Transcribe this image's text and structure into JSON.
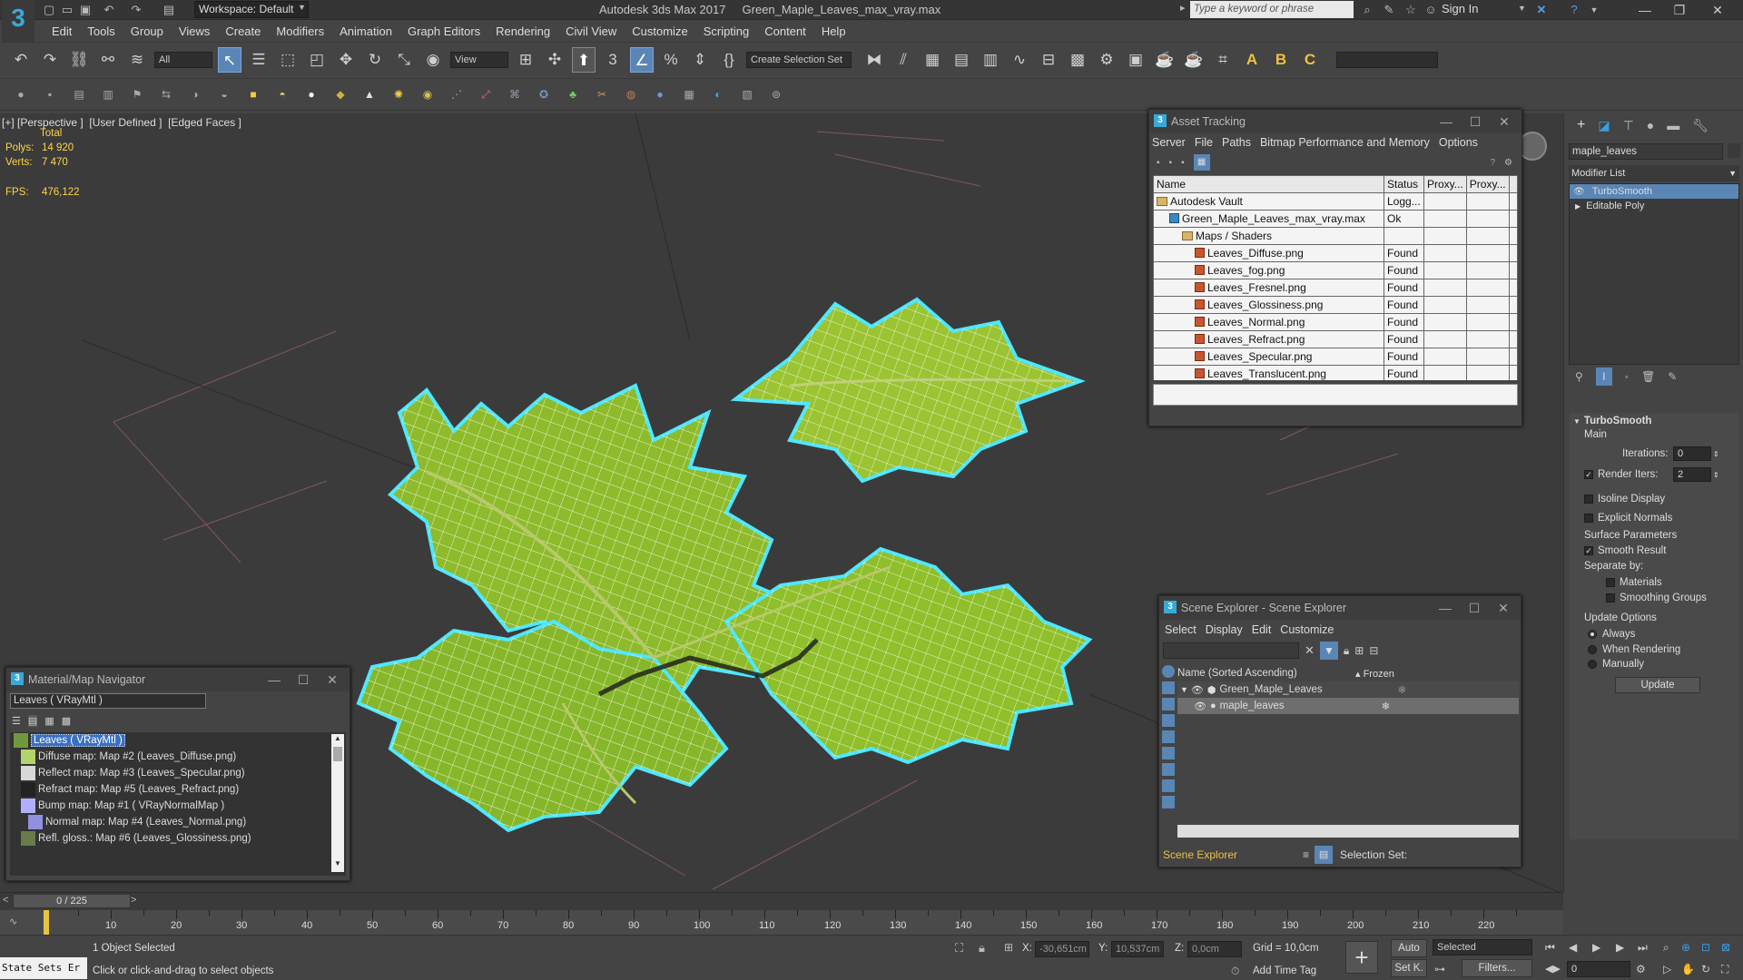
{
  "app": {
    "logo": "3",
    "workspace": "Workspace: Default",
    "title": "Autodesk 3ds Max 2017     Green_Maple_Leaves_max_vray.max",
    "search_placeholder": "Type a keyword or phrase",
    "sign_in": "Sign In",
    "accent": "#5a86b5"
  },
  "menu": [
    "Edit",
    "Tools",
    "Group",
    "Views",
    "Create",
    "Modifiers",
    "Animation",
    "Graph Editors",
    "Rendering",
    "Civil View",
    "Customize",
    "Scripting",
    "Content",
    "Help"
  ],
  "toolbar": {
    "filter": "All",
    "refcoord": "View",
    "selection_set": "Create Selection Set"
  },
  "viewport": {
    "label": "[+] [Perspective ]  [User Defined ]  [Edged Faces ]",
    "total": "Total",
    "polys_label": "Polys:",
    "polys": "14 920",
    "verts_label": "Verts:",
    "verts": "7 470",
    "fps_label": "FPS:",
    "fps": "476,122",
    "mesh_color": "#8fbf2a",
    "outline_color": "#4fe7ff"
  },
  "asset_tracking": {
    "title": "Asset Tracking",
    "menu": [
      "Server",
      "File",
      "Paths",
      "Bitmap Performance and Memory",
      "Options"
    ],
    "columns": [
      "Name",
      "Status",
      "Proxy...",
      "Proxy..."
    ],
    "rows": [
      {
        "name": "Autodesk Vault",
        "status": "Logg...",
        "type": "folder",
        "indent": 0
      },
      {
        "name": "Green_Maple_Leaves_max_vray.max",
        "status": "Ok",
        "type": "max",
        "indent": 1
      },
      {
        "name": "Maps / Shaders",
        "status": "",
        "type": "folder",
        "indent": 2
      },
      {
        "name": "Leaves_Diffuse.png",
        "status": "Found",
        "type": "file",
        "indent": 3
      },
      {
        "name": "Leaves_fog.png",
        "status": "Found",
        "type": "file",
        "indent": 3
      },
      {
        "name": "Leaves_Fresnel.png",
        "status": "Found",
        "type": "file",
        "indent": 3
      },
      {
        "name": "Leaves_Glossiness.png",
        "status": "Found",
        "type": "file",
        "indent": 3
      },
      {
        "name": "Leaves_Normal.png",
        "status": "Found",
        "type": "file",
        "indent": 3
      },
      {
        "name": "Leaves_Refract.png",
        "status": "Found",
        "type": "file",
        "indent": 3
      },
      {
        "name": "Leaves_Specular.png",
        "status": "Found",
        "type": "file",
        "indent": 3
      },
      {
        "name": "Leaves_Translucent.png",
        "status": "Found",
        "type": "file",
        "indent": 3
      }
    ]
  },
  "material_navigator": {
    "title": "Material/Map Navigator",
    "current": "Leaves  ( VRayMtl )",
    "items": [
      {
        "label": "Leaves  ( VRayMtl )",
        "indent": 0,
        "selected": true
      },
      {
        "label": "Diffuse map: Map #2 (Leaves_Diffuse.png)",
        "indent": 1
      },
      {
        "label": "Reflect map: Map #3 (Leaves_Specular.png)",
        "indent": 1
      },
      {
        "label": "Refract map: Map #5 (Leaves_Refract.png)",
        "indent": 1
      },
      {
        "label": "Bump map: Map #1  ( VRayNormalMap )",
        "indent": 1
      },
      {
        "label": "Normal map: Map #4 (Leaves_Normal.png)",
        "indent": 2
      },
      {
        "label": "Refl. gloss.: Map #6 (Leaves_Glossiness.png)",
        "indent": 1
      }
    ]
  },
  "scene_explorer": {
    "title": "Scene Explorer - Scene Explorer",
    "menu": [
      "Select",
      "Display",
      "Edit",
      "Customize"
    ],
    "col_name": "Name (Sorted Ascending)",
    "col_frozen": "▴ Frozen",
    "rows": [
      {
        "name": "Green_Maple_Leaves",
        "indent": 0
      },
      {
        "name": "maple_leaves",
        "indent": 1,
        "selected": true
      }
    ],
    "footer": "Scene Explorer",
    "selection_set": "Selection Set:"
  },
  "command_panel": {
    "object_name": "maple_leaves",
    "modifier_list": "Modifier List",
    "stack": [
      {
        "label": "TurboSmooth",
        "selected": true
      },
      {
        "label": "Editable Poly",
        "selected": false
      }
    ],
    "rollout": "TurboSmooth",
    "main": "Main",
    "iterations_label": "Iterations:",
    "iterations": "0",
    "render_iters_label": "Render Iters:",
    "render_iters": "2",
    "isoline": "Isoline Display",
    "explicit_normals": "Explicit Normals",
    "surface_params": "Surface Parameters",
    "smooth_result": "Smooth Result",
    "separate_by": "Separate by:",
    "materials": "Materials",
    "smoothing_groups": "Smoothing Groups",
    "update_options": "Update Options",
    "always": "Always",
    "when_rendering": "When Rendering",
    "manually": "Manually",
    "update_btn": "Update"
  },
  "timeline": {
    "frame": "0 / 225",
    "current": 0,
    "total": 225,
    "ticks": [
      "10",
      "20",
      "30",
      "40",
      "50",
      "60",
      "70",
      "80",
      "90",
      "100",
      "110",
      "120",
      "130",
      "140",
      "150",
      "160",
      "170",
      "180",
      "190",
      "200",
      "210",
      "220"
    ]
  },
  "status": {
    "script_label": "State Sets Er",
    "selected": "1 Object Selected",
    "prompt": "Click or click-and-drag to select objects",
    "x_label": "X:",
    "x": "-30,651cm",
    "y_label": "Y:",
    "y": "10,537cm",
    "z_label": "Z:",
    "z": "0,0cm",
    "grid": "Grid = 10,0cm",
    "add_time_tag": "Add Time Tag",
    "auto": "Auto",
    "setk": "Set K.",
    "selected_dd": "Selected",
    "filters": "Filters...",
    "frame_field": "0"
  }
}
